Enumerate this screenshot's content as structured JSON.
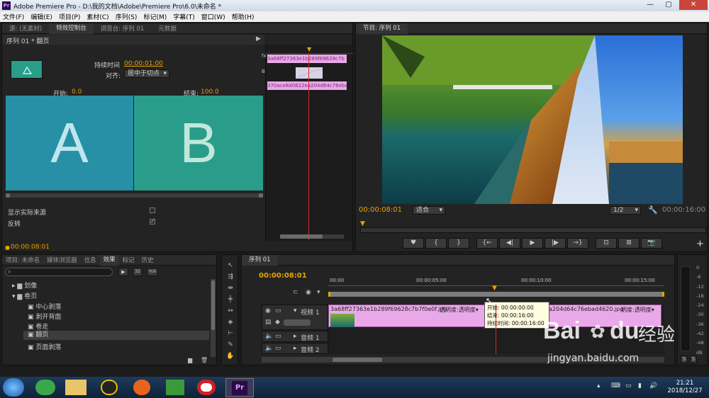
{
  "titlebar": {
    "logo": "Pr",
    "title": "Adobe Premiere Pro - D:\\我的文档\\Adobe\\Premiere Pro\\6.0\\未命名 *",
    "min": "—",
    "max": "▢",
    "close": "✕"
  },
  "menu": [
    "文件(F)",
    "编辑(E)",
    "项目(P)",
    "素材(C)",
    "序列(S)",
    "标记(M)",
    "字幕(T)",
    "窗口(W)",
    "帮助(H)"
  ],
  "effect_controls": {
    "tabs": [
      "源: (无素材)",
      "特效控制台",
      "调音台: 序列 01",
      "元数据"
    ],
    "header": "序列 01 * 翻页",
    "duration_label": "持续时间",
    "duration_value": "00:00:01:00",
    "align_label": "对齐:",
    "align_value": "居中于切点",
    "start_label": "开始:",
    "start_value": "0.0",
    "end_label": "结束:",
    "end_value": "100.0",
    "preview_a": "A",
    "preview_b": "B",
    "show_actual_label": "显示实际来源",
    "reverse_label": "反转",
    "reverse_checkmark": "✓",
    "timecode": "00:00:08:01",
    "mini_clip_top": "3a68ff27363e1b289f69628c7b",
    "mini_clip_bottom": "370ace8d0822ea204d64c76ebad",
    "fx_label": "fx",
    "b_label": "B"
  },
  "program": {
    "tab": "节目: 序列 01",
    "timecode": "00:00:08:01",
    "fit": "适合",
    "resolution": "1/2",
    "duration": "00:00:16:00",
    "controls": [
      "♥",
      "{",
      "}",
      "{←",
      "◀|",
      "▶",
      "|▶",
      "→}",
      "⊡",
      "⊞",
      "📷"
    ],
    "plus": "+"
  },
  "project": {
    "tabs": [
      "项目: 未命名",
      "媒体浏览器",
      "信息",
      "效果",
      "标记",
      "历史"
    ],
    "tree": [
      {
        "label": "划像",
        "type": "folder",
        "level": 1
      },
      {
        "label": "卷页",
        "type": "folder",
        "level": 1
      },
      {
        "label": "中心剥落",
        "type": "item",
        "level": 2
      },
      {
        "label": "剥开背面",
        "type": "item",
        "level": 2
      },
      {
        "label": "卷走",
        "type": "item",
        "level": 2
      },
      {
        "label": "翻页",
        "type": "item",
        "level": 2,
        "selected": true
      },
      {
        "label": "页面剥落",
        "type": "item",
        "level": 2
      }
    ],
    "badges": [
      "32",
      "YUV"
    ]
  },
  "timeline": {
    "tab": "序列 01",
    "timecode": "00:00:08:01",
    "ruler": [
      "00:00",
      "00:00:05:00",
      "00:00:10:00",
      "00:00:15:00"
    ],
    "tracks": {
      "video1": "视频 1",
      "audio1": "音频 1",
      "audio2": "音频 2"
    },
    "clip1_name": "3a68ff27363e1b289f69628c7b7f0e0f.jpg",
    "clip1_fx": "透明度:透明度▾",
    "clip2_name": "a204d64c76ebad4620.jpg",
    "clip2_fx": "明度:透明度▾",
    "tooltip": {
      "start": "开始: 00:00:00:00",
      "end": "结束: 00:00:16:00",
      "duration": "持续时间: 00:00:16:00"
    }
  },
  "audio_meter": {
    "labels": [
      "0",
      "-6",
      "-12",
      "-18",
      "-24",
      "-30",
      "-36",
      "-42",
      "-48",
      "dB"
    ],
    "solo": [
      "S",
      "S"
    ]
  },
  "taskbar": {
    "time": "21:21",
    "date": "2018/12/27",
    "pr_label": "Pr"
  },
  "watermark": {
    "brand": "Bai",
    "du": "du",
    "cn": "经验",
    "url": "jingyan.baidu.com"
  },
  "colors": {
    "accent": "#e8a200",
    "clip_pink": "#e9a9e8",
    "preview_teal": "#2a9c8a",
    "playhead": "#d12b2b"
  }
}
